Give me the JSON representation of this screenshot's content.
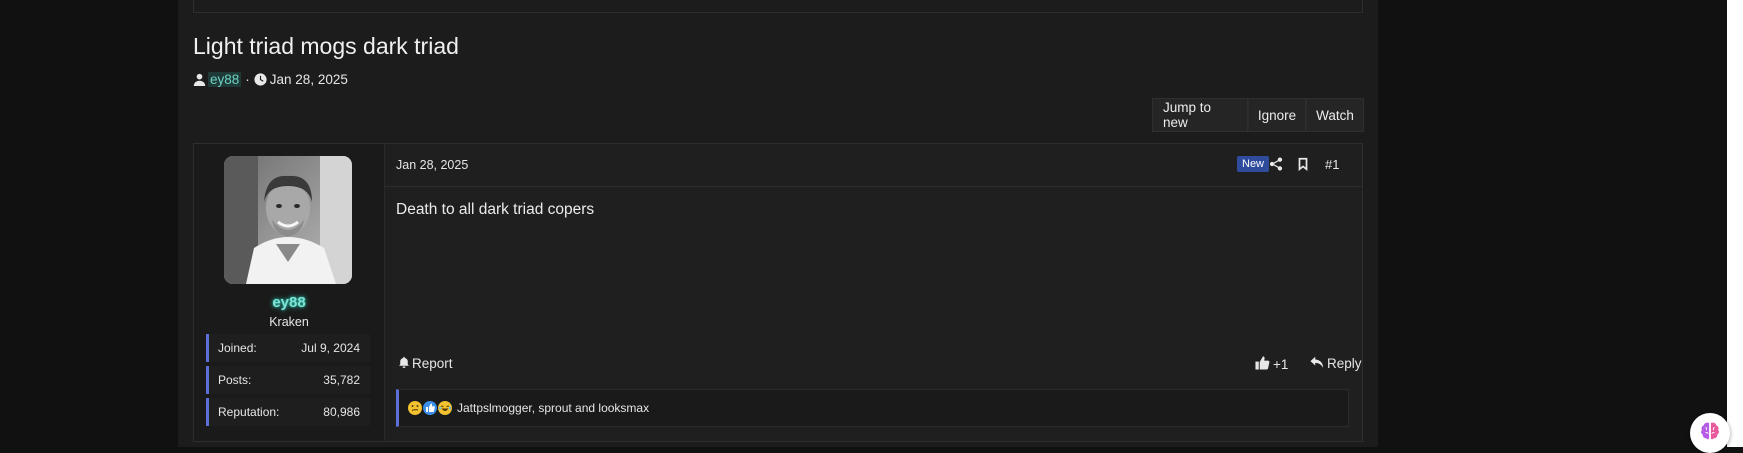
{
  "thread": {
    "title": "Light triad mogs dark triad",
    "author": "ey88",
    "meta_separator": "·",
    "start_date": "Jan 28, 2025"
  },
  "thread_actions": {
    "jump_to_new": "Jump to new",
    "ignore": "Ignore",
    "watch": "Watch"
  },
  "post": {
    "user": {
      "name": "ey88",
      "title": "Kraken",
      "stats": [
        {
          "label": "Joined:",
          "value": "Jul 9, 2024"
        },
        {
          "label": "Posts:",
          "value": "35,782"
        },
        {
          "label": "Reputation:",
          "value": "80,986"
        }
      ]
    },
    "date": "Jan 28, 2025",
    "badge": "New",
    "number": "#1",
    "body": "Death to all dark triad copers",
    "report_label": "Report",
    "reaction_label": "+1",
    "reply_label": "Reply",
    "reactions": {
      "users_text": "Jattpslmogger, sprout and looksmax",
      "icons": [
        "thinking-face-emoji",
        "thumbs-up-emoji",
        "laughing-face-emoji"
      ]
    }
  },
  "colors": {
    "page_background": "#111111",
    "panel_background": "#1c1c1c",
    "username_glow": "#7ee3d6",
    "stat_accent": "#5b6fd6",
    "new_badge": "#2f4b9c"
  },
  "icons": [
    "user-icon",
    "clock-icon",
    "share-icon",
    "bookmark-icon",
    "bell-icon",
    "thumbs-up-icon",
    "reply-icon",
    "brain-icon"
  ]
}
